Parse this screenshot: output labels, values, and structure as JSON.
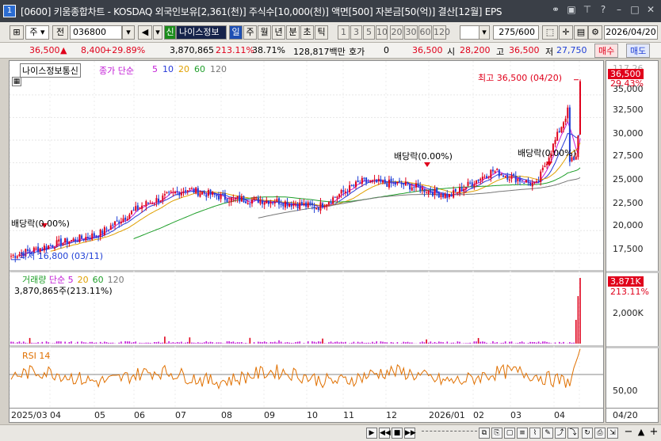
{
  "titlebar": {
    "number": "1",
    "text": "[0600] 키움종합차트 - KOSDAQ 외국인보유[2,361(천)] 주식수[10,000(천)] 액면[500] 자본금[50(억)] 결산[12월] EPS"
  },
  "toolbar": {
    "period_label": "주",
    "prev_label": "전",
    "code": "036800",
    "new_badge": "신",
    "stock_name": "나이스정보",
    "periods": [
      "일",
      "주",
      "월",
      "년",
      "분",
      "초",
      "틱"
    ],
    "intervals": [
      "1",
      "3",
      "5",
      "10",
      "20",
      "30",
      "60",
      "120"
    ],
    "count": "275",
    "count_max": "/600",
    "date": "2026/04/20"
  },
  "quote": {
    "price": "36,500",
    "change": "8,400",
    "change_pct": "+29.89%",
    "volume": "3,870,865",
    "volume_ratio": "213.11%",
    "turnover": "38.71%",
    "amount": "128,817백만",
    "hoga_label": "호가",
    "hoga": "0",
    "sell_price": "36,500",
    "open_label": "시",
    "open": "28,200",
    "high_label": "고",
    "high": "36,500",
    "low_label": "저",
    "low": "27,750",
    "buy_btn": "매수",
    "sell_btn": "매도"
  },
  "price_panel": {
    "stock_label": "나이스정보통신",
    "ma_label": "종가 단순",
    "ma": [
      "5",
      "10",
      "20",
      "60",
      "120"
    ],
    "ma_colors": [
      "#c21bd6",
      "#2538d8",
      "#e0a000",
      "#1f9f2a",
      "#777777"
    ],
    "high_note": "최고 36,500 (04/20)",
    "low_note": "최저 16,800 (03/11)",
    "dividends": [
      "배당락(0.00%)",
      "배당락(0.00%)",
      "배당락(0.00%)"
    ],
    "y_ticks": [
      "117.26",
      "35,000",
      "32,500",
      "30,000",
      "27,500",
      "25,000",
      "22,500",
      "20,000",
      "17,500"
    ],
    "price_tag": "36,500",
    "pct_tag": "29.43%"
  },
  "volume_panel": {
    "label": "거래량",
    "ma_label": "단순",
    "ma": [
      "5",
      "20",
      "60",
      "120"
    ],
    "value": "3,870,865주(213.11%)",
    "y_tick": "2,000K",
    "tag": "3,871K",
    "pct": "213.11%"
  },
  "rsi_panel": {
    "label": "RSI 14",
    "y_tick": "50,00"
  },
  "x_axis": {
    "labels": [
      "2025/03",
      "04",
      "05",
      "06",
      "07",
      "08",
      "09",
      "10",
      "11",
      "12",
      "2026/01",
      "02",
      "03",
      "04"
    ],
    "right": "04/20"
  },
  "chart_data": {
    "type": "candlestick",
    "title": "나이스정보통신",
    "x_range": [
      "2025/03",
      "2026/04/20"
    ],
    "y_range": [
      16000,
      37000
    ],
    "month_close": [
      {
        "m": "2025/03",
        "close": 17200
      },
      {
        "m": "04",
        "close": 18500
      },
      {
        "m": "05",
        "close": 19600
      },
      {
        "m": "06",
        "close": 22800
      },
      {
        "m": "07",
        "close": 24600
      },
      {
        "m": "08",
        "close": 23500
      },
      {
        "m": "09",
        "close": 23300
      },
      {
        "m": "10",
        "close": 22600
      },
      {
        "m": "11",
        "close": 25400
      },
      {
        "m": "12",
        "close": 25100
      },
      {
        "m": "2026/01",
        "close": 23800
      },
      {
        "m": "02",
        "close": 26600
      },
      {
        "m": "03",
        "close": 25000
      },
      {
        "m": "04",
        "close": 36500
      }
    ],
    "high": 36500,
    "low": 16800
  }
}
